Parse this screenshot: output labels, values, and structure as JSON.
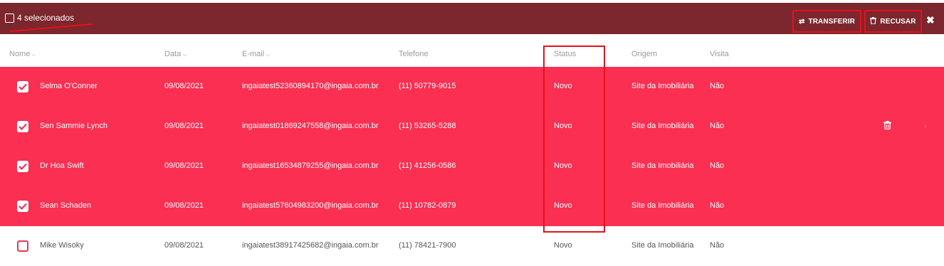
{
  "selection": {
    "count_label": "4 selecionados"
  },
  "actions": {
    "transfer_label": "TRANSFERIR",
    "refuse_label": "RECUSAR",
    "close_label": "✖"
  },
  "columns": {
    "nome": "Nome",
    "data": "Data",
    "email": "E-mail",
    "telefone": "Telefone",
    "status": "Status",
    "origem": "Origem",
    "visita": "Visita"
  },
  "rows": [
    {
      "selected": true,
      "nome": "Selma O'Conner",
      "data": "09/08/2021",
      "email": "ingaiatest52360894170@ingaia.com.br",
      "telefone": "(11) 50779-9015",
      "status": "Novo",
      "origem": "Site da Imobiliária",
      "visita": "Não"
    },
    {
      "selected": true,
      "nome": "Sen Sammie Lynch",
      "data": "09/08/2021",
      "email": "ingaiatest01869247558@ingaia.com.br",
      "telefone": "(11) 53265-5288",
      "status": "Novo",
      "origem": "Site da Imobiliária",
      "visita": "Não"
    },
    {
      "selected": true,
      "nome": "Dr Hoa Swift",
      "data": "09/08/2021",
      "email": "ingaiatest16534879255@ingaia.com.br",
      "telefone": "(11) 41256-0586",
      "status": "Novo",
      "origem": "Site da Imobiliária",
      "visita": "Não"
    },
    {
      "selected": true,
      "nome": "Sean Schaden",
      "data": "09/08/2021",
      "email": "ingaiatest57604983200@ingaia.com.br",
      "telefone": "(11) 10782-0879",
      "status": "Novo",
      "origem": "Site da Imobiliária",
      "visita": "Não"
    },
    {
      "selected": false,
      "nome": "Mike Wisoky",
      "data": "09/08/2021",
      "email": "ingaiatest38917425682@ingaia.com.br",
      "telefone": "(11) 78421-7900",
      "status": "Novo",
      "origem": "Site da Imobiliária",
      "visita": "Não"
    }
  ],
  "colors": {
    "selection_bar": "#7b272d",
    "selected_row": "#fa2f52",
    "highlight_box": "#e8101a"
  }
}
